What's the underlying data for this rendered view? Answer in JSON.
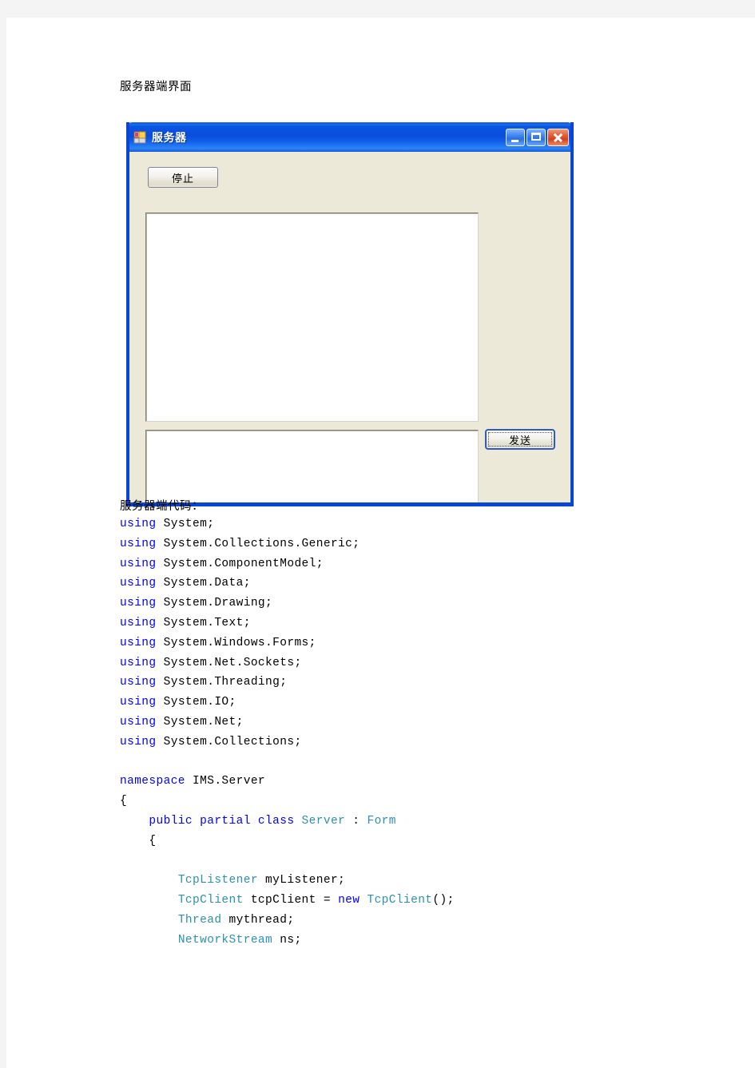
{
  "document": {
    "heading_ui": "服务器端界面",
    "heading_code": "服务器端代码：",
    "code_lines": [
      [
        {
          "t": "using",
          "c": "kw"
        },
        {
          "t": " System;",
          "c": ""
        }
      ],
      [
        {
          "t": "using",
          "c": "kw"
        },
        {
          "t": " System.Collections.Generic;",
          "c": ""
        }
      ],
      [
        {
          "t": "using",
          "c": "kw"
        },
        {
          "t": " System.ComponentModel;",
          "c": ""
        }
      ],
      [
        {
          "t": "using",
          "c": "kw"
        },
        {
          "t": " System.Data;",
          "c": ""
        }
      ],
      [
        {
          "t": "using",
          "c": "kw"
        },
        {
          "t": " System.Drawing;",
          "c": ""
        }
      ],
      [
        {
          "t": "using",
          "c": "kw"
        },
        {
          "t": " System.Text;",
          "c": ""
        }
      ],
      [
        {
          "t": "using",
          "c": "kw"
        },
        {
          "t": " System.Windows.Forms;",
          "c": ""
        }
      ],
      [
        {
          "t": "using",
          "c": "kw"
        },
        {
          "t": " System.Net.Sockets;",
          "c": ""
        }
      ],
      [
        {
          "t": "using",
          "c": "kw"
        },
        {
          "t": " System.Threading;",
          "c": ""
        }
      ],
      [
        {
          "t": "using",
          "c": "kw"
        },
        {
          "t": " System.IO;",
          "c": ""
        }
      ],
      [
        {
          "t": "using",
          "c": "kw"
        },
        {
          "t": " System.Net;",
          "c": ""
        }
      ],
      [
        {
          "t": "using",
          "c": "kw"
        },
        {
          "t": " System.Collections;",
          "c": ""
        }
      ],
      [],
      [
        {
          "t": "namespace",
          "c": "kw"
        },
        {
          "t": " IMS.Server",
          "c": ""
        }
      ],
      [
        {
          "t": "{",
          "c": ""
        }
      ],
      [
        {
          "t": "    public partial class ",
          "c": "kw"
        },
        {
          "t": "Server",
          "c": "typ"
        },
        {
          "t": " : ",
          "c": ""
        },
        {
          "t": "Form",
          "c": "typ"
        }
      ],
      [
        {
          "t": "    {",
          "c": ""
        }
      ],
      [],
      [
        {
          "t": "        ",
          "c": ""
        },
        {
          "t": "TcpListener",
          "c": "typ"
        },
        {
          "t": " myListener;",
          "c": ""
        }
      ],
      [
        {
          "t": "        ",
          "c": ""
        },
        {
          "t": "TcpClient",
          "c": "typ"
        },
        {
          "t": " tcpClient = ",
          "c": ""
        },
        {
          "t": "new",
          "c": "kw"
        },
        {
          "t": " ",
          "c": ""
        },
        {
          "t": "TcpClient",
          "c": "typ"
        },
        {
          "t": "();",
          "c": ""
        }
      ],
      [
        {
          "t": "        ",
          "c": ""
        },
        {
          "t": "Thread",
          "c": "typ"
        },
        {
          "t": " mythread;",
          "c": ""
        }
      ],
      [
        {
          "t": "        ",
          "c": ""
        },
        {
          "t": "NetworkStream",
          "c": "typ"
        },
        {
          "t": " ns;",
          "c": ""
        }
      ]
    ]
  },
  "winform": {
    "title": "服务器",
    "icon": "windows-form-icon",
    "caption_buttons": [
      {
        "name": "minimize-button",
        "glyph": "minimize-icon"
      },
      {
        "name": "maximize-button",
        "glyph": "maximize-icon"
      },
      {
        "name": "close-button",
        "glyph": "close-icon"
      }
    ],
    "stop_button_label": "停止",
    "send_button_label": "发送",
    "log_textbox_value": "",
    "message_textbox_value": "",
    "colors": {
      "title_bar_blue": "#0a4ddc",
      "form_border_blue": "#0a46d2",
      "control_face": "#ece9d8",
      "close_button_red": "#d2401c"
    }
  },
  "code_colors": {
    "keyword": "#0000ff",
    "type": "#2b91af",
    "plain": "#000000"
  }
}
